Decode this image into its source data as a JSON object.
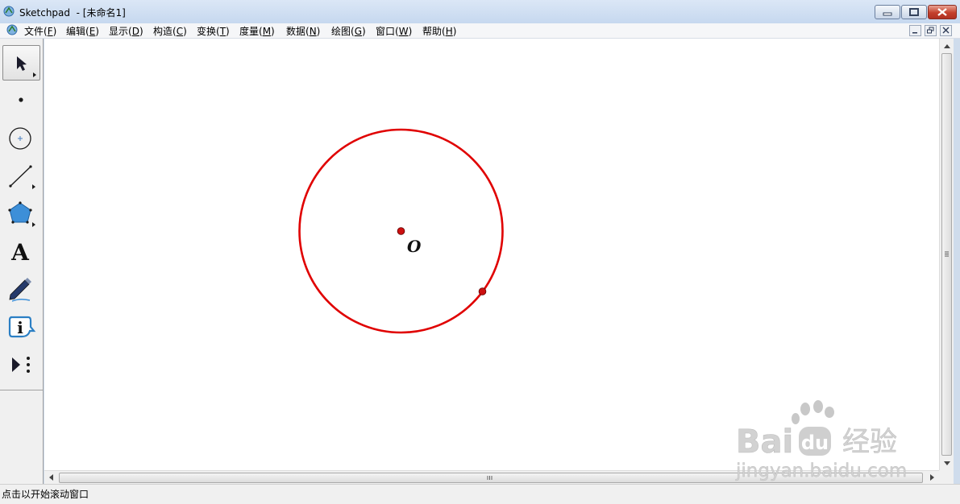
{
  "window": {
    "app_name": "Sketchpad",
    "title": "Sketchpad  - [未命名1]"
  },
  "menu": [
    {
      "label": "文件",
      "accel": "F",
      "suffix": "(F)"
    },
    {
      "label": "编辑",
      "accel": "E",
      "suffix": "(E)"
    },
    {
      "label": "显示",
      "accel": "D",
      "suffix": "(D)"
    },
    {
      "label": "构造",
      "accel": "C",
      "suffix": "(C)"
    },
    {
      "label": "变换",
      "accel": "T",
      "suffix": "(T)"
    },
    {
      "label": "度量",
      "accel": "M",
      "suffix": "(M)"
    },
    {
      "label": "数据",
      "accel": "N",
      "suffix": "(N)"
    },
    {
      "label": "绘图",
      "accel": "G",
      "suffix": "(G)"
    },
    {
      "label": "窗口",
      "accel": "W",
      "suffix": "(W)"
    },
    {
      "label": "帮助",
      "accel": "H",
      "suffix": "(H)"
    }
  ],
  "toolbox": {
    "tools": [
      {
        "name": "arrow-tool",
        "icon": "arrow-select-icon",
        "selected": true
      },
      {
        "name": "point-tool",
        "icon": "point-icon"
      },
      {
        "name": "compass-tool",
        "icon": "compass-icon"
      },
      {
        "name": "straightedge-tool",
        "icon": "segment-icon"
      },
      {
        "name": "polygon-tool",
        "icon": "polygon-icon"
      },
      {
        "name": "text-tool",
        "icon": "text-icon",
        "glyph": "A"
      },
      {
        "name": "marker-tool",
        "icon": "marker-pen-icon"
      },
      {
        "name": "information-tool",
        "icon": "info-icon",
        "glyph": "i"
      },
      {
        "name": "custom-tool",
        "icon": "custom-tools-icon"
      }
    ]
  },
  "sketch": {
    "center_label": "O",
    "circle_color": "#e00000",
    "point_color": "#cc1010"
  },
  "status": {
    "text": "点击以开始滚动窗口"
  },
  "watermark": {
    "brand": "Bai",
    "brand_tail": "du",
    "cn": "经验",
    "url": "jingyan.baidu.com"
  }
}
